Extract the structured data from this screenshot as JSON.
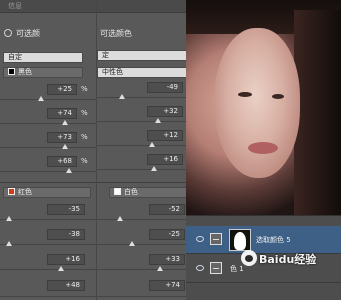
{
  "panel_left": {
    "title": "信息",
    "header": "可选颜",
    "preset": "自定",
    "color_select": "黑色",
    "color_swatch": "#000000",
    "values": [
      "+25",
      "+74",
      "+73",
      "+68"
    ],
    "unit": "%",
    "color_select2": "红色",
    "color_swatch2": "#d23a1a",
    "values2": [
      "-35",
      "-38",
      "+16",
      "+48"
    ]
  },
  "panel_right": {
    "header": "可选颜色",
    "preset": "定",
    "color_select": "中性色",
    "values": [
      "-49",
      "+32",
      "+12",
      "+16"
    ],
    "color_select2": "白色",
    "color_swatch2": "#ffffff",
    "values2": [
      "-52",
      "-25",
      "+33",
      "+74"
    ]
  },
  "layers": {
    "row1_name": "选取颜色 5",
    "row2_name": "色 1",
    "selected_color": "#3e6087"
  },
  "watermark": {
    "text": "Baidu经验"
  },
  "icons": [
    "mask-icon",
    "eye-icon",
    "adjustment-layer-icon",
    "layer-mask-thumbnail"
  ]
}
